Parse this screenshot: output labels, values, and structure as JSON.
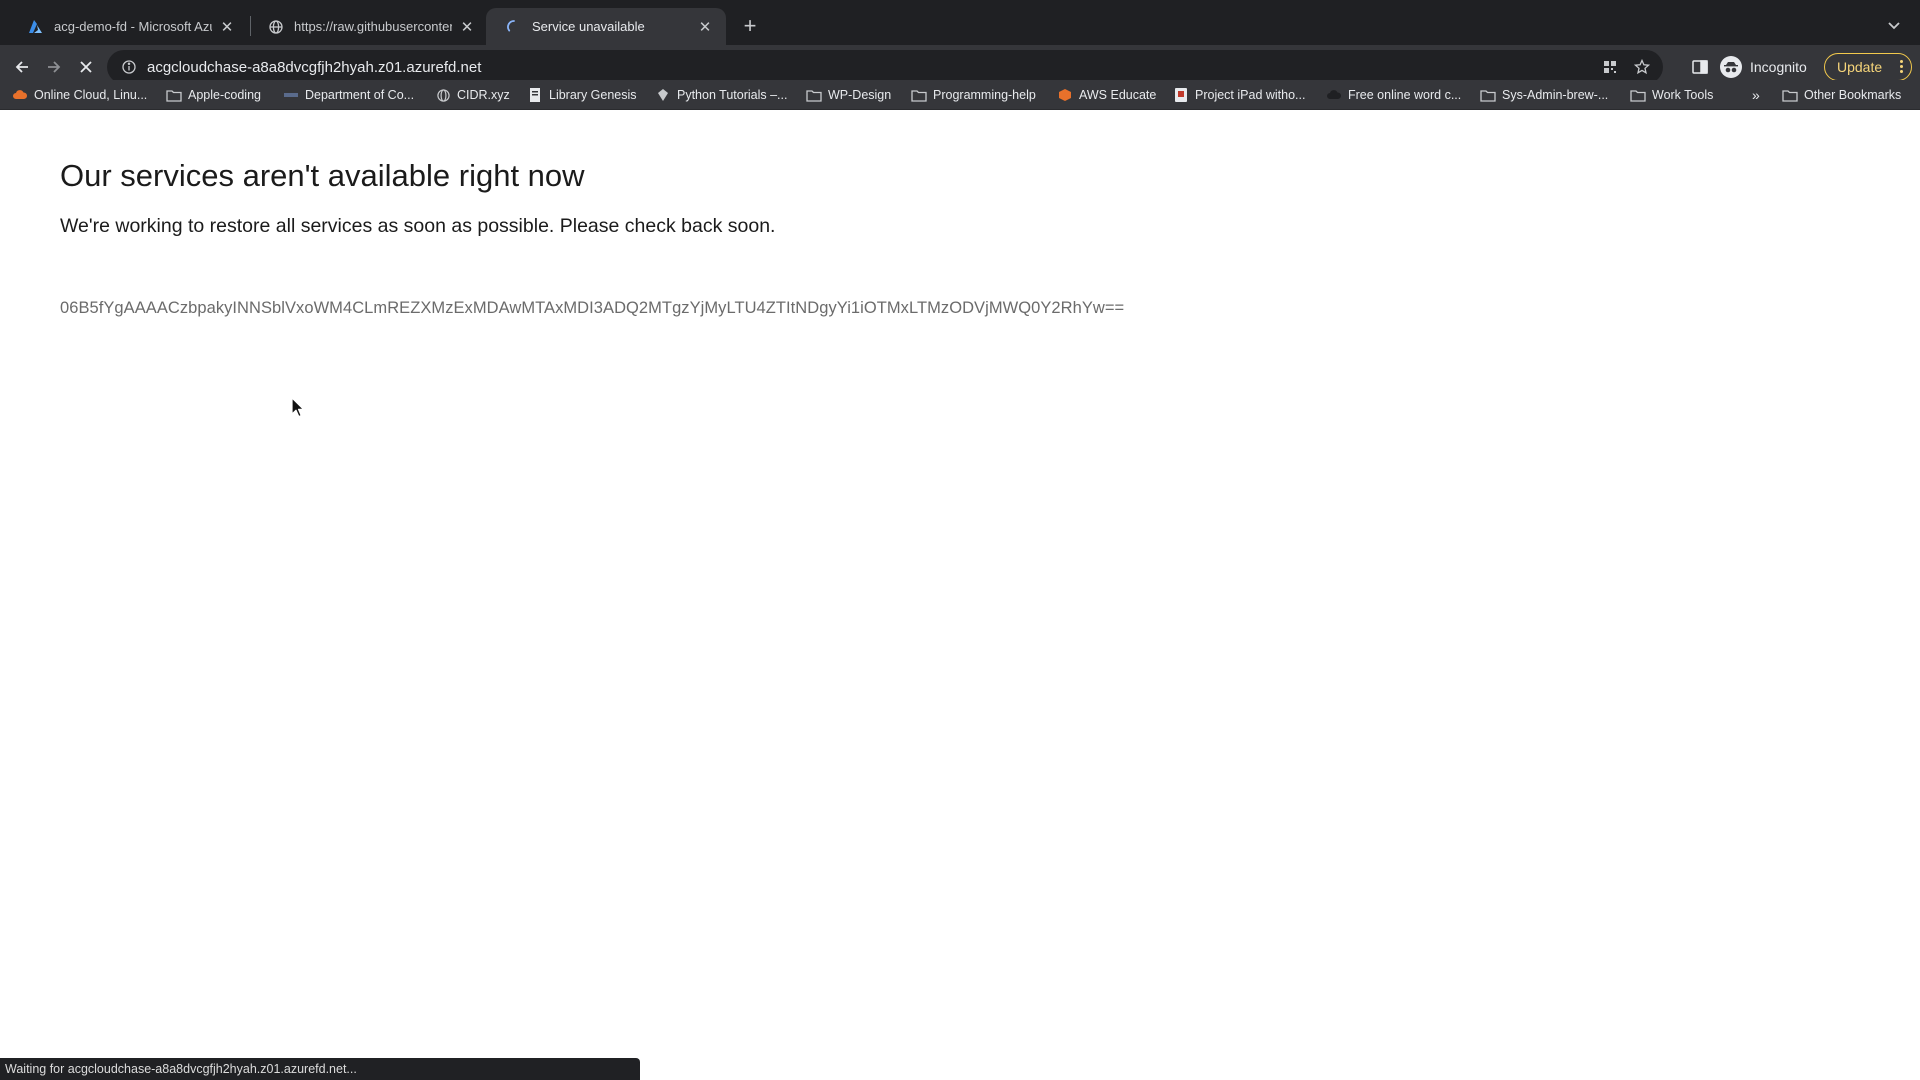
{
  "tabs": [
    {
      "title": "acg-demo-fd - Microsoft Azure",
      "favicon": "azure-icon",
      "active": false
    },
    {
      "title": "https://raw.githubusercontent.com",
      "favicon": "globe-icon",
      "active": false
    },
    {
      "title": "Service unavailable",
      "favicon": "loading-spinner-icon",
      "active": true
    }
  ],
  "toolbar": {
    "url": "acgcloudchase-a8a8dvcgfjh2hyah.z01.azurefd.net",
    "profile_label": "Incognito",
    "update_label": "Update"
  },
  "bookmarks": [
    {
      "label": "Online Cloud, Linu...",
      "icon": "cloud-icon"
    },
    {
      "label": "Apple-coding",
      "icon": "folder-icon"
    },
    {
      "label": "Department of Co...",
      "icon": "site-icon"
    },
    {
      "label": "CIDR.xyz",
      "icon": "globe-icon"
    },
    {
      "label": "Library Genesis",
      "icon": "book-icon"
    },
    {
      "label": "Python Tutorials –...",
      "icon": "python-icon"
    },
    {
      "label": "WP-Design",
      "icon": "folder-icon"
    },
    {
      "label": "Programming-help",
      "icon": "folder-icon"
    },
    {
      "label": "AWS Educate",
      "icon": "aws-icon"
    },
    {
      "label": "Project iPad witho...",
      "icon": "site-icon"
    },
    {
      "label": "Free online word c...",
      "icon": "cloud-icon"
    },
    {
      "label": "Sys-Admin-brew-...",
      "icon": "folder-icon"
    },
    {
      "label": "Work Tools",
      "icon": "folder-icon"
    }
  ],
  "bookmarks_overflow": "»",
  "other_bookmarks": "Other Bookmarks",
  "page": {
    "heading": "Our services aren't available right now",
    "message": "We're working to restore all services as soon as possible. Please check back soon.",
    "reference_id": "06B5fYgAAAACzbpakyINNSblVxoWM4CLmREZXMzExMDAwMTAxMDI3ADQ2MTgzYjMyLTU4ZTItNDgyYi1iOTMxLTMzODVjMWQ0Y2RhYw=="
  },
  "status_bar": "Waiting for acgcloudchase-a8a8dvcgfjh2hyah.z01.azurefd.net...",
  "colors": {
    "tab_strip_bg": "#1f2023",
    "toolbar_bg": "#35363a",
    "update_accent": "#f2c94c"
  }
}
